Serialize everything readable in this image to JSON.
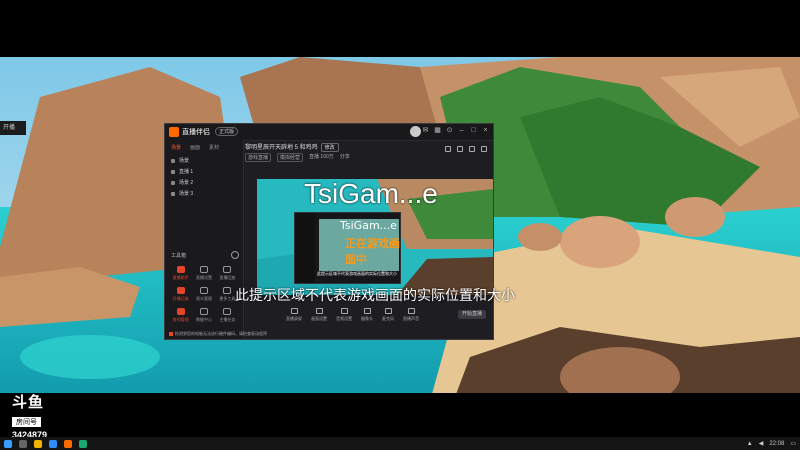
{
  "app": {
    "name": "直播伴侣",
    "version": "正式版",
    "window_controls": [
      "pin-icon",
      "minimize-icon",
      "restore-icon",
      "close-icon"
    ]
  },
  "scenes_tabs": [
    "场景",
    "画面",
    "素材"
  ],
  "scenes": [
    "场景",
    "直播 1",
    "场景 2",
    "场景 3"
  ],
  "sources_title": "工具箱",
  "tools": [
    {
      "label": "直播助手",
      "hot": true
    },
    {
      "label": "直播设置",
      "hot": false
    },
    {
      "label": "直播回放",
      "hot": false
    },
    {
      "label": "开播记录",
      "hot": true
    },
    {
      "label": "观众管理",
      "hot": false
    },
    {
      "label": "更多工具",
      "hot": false
    },
    {
      "label": "房间管理",
      "hot": true
    },
    {
      "label": "数据中心",
      "hot": false
    },
    {
      "label": "主播任务",
      "hot": false
    }
  ],
  "room": {
    "title": "黎明星辰开天辟地 5 和鸡鸡",
    "badge": "修改",
    "sub": [
      "游戏直播",
      "模拟经营"
    ],
    "sub_extra": "直播 100万",
    "sub_extra2": "分享"
  },
  "preview": {
    "overlay_logo": "TsiGam...e",
    "inner_logo": "TsiGam...e",
    "inner_warning": "正在游戏画面中",
    "inner_hint": "此提示区域不代表游戏画面的实际位置和大小",
    "hint": "此提示区域不代表游戏画面的实际位置和大小"
  },
  "bottom_tools": [
    "直播录屏",
    "画面设置",
    "音频设置",
    "摄像头",
    "麦克风",
    "直播声音"
  ],
  "start_button": "开始直播",
  "status_text": "检测到您的电脑无法进行硬件编码，请检查驱动程序",
  "side_tab": "开播",
  "logo": {
    "mark": "斗鱼",
    "sub": "房间号",
    "room_number": "3424879"
  },
  "tray_time": "22:08"
}
